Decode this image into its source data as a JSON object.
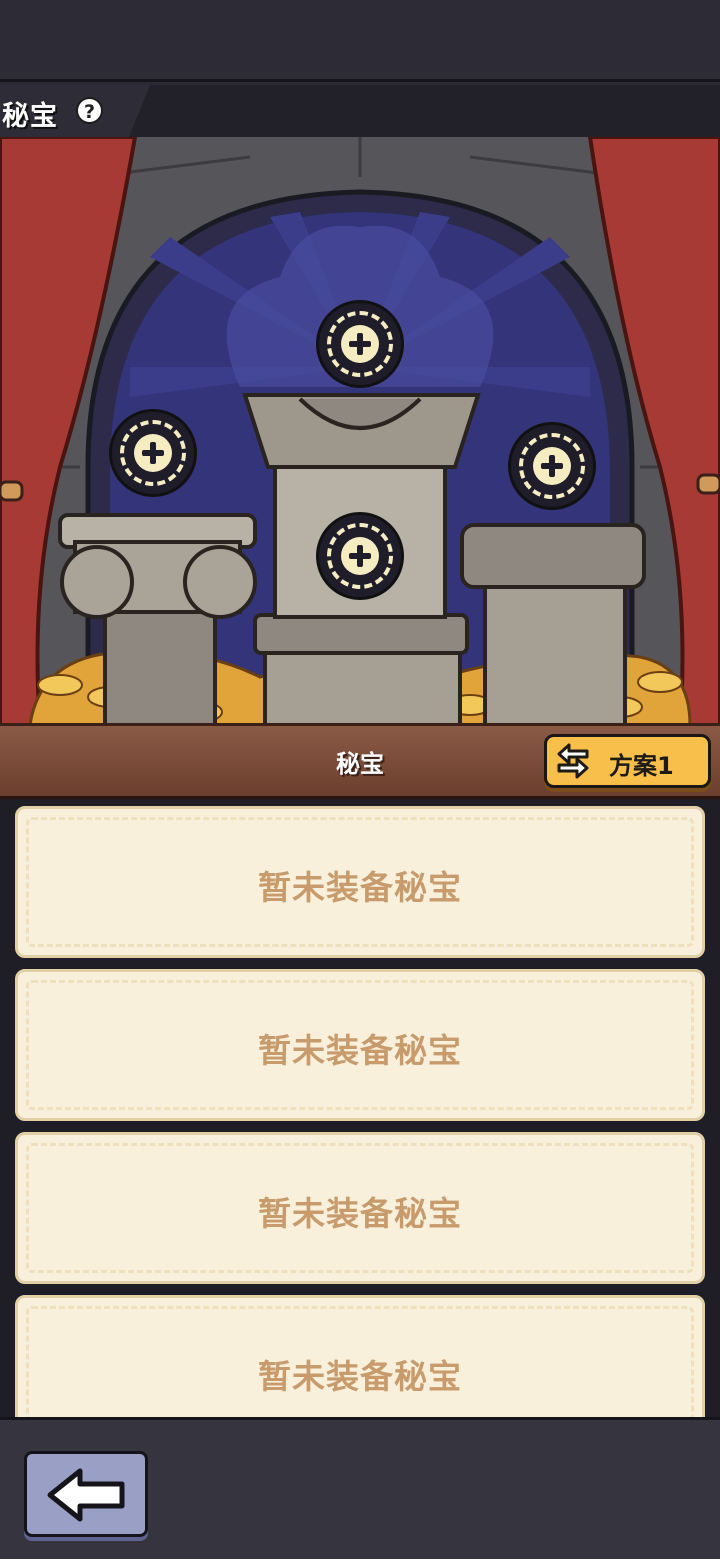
{
  "header": {
    "title": "秘宝",
    "help_icon": "question-icon",
    "help_glyph": "?"
  },
  "scene": {
    "slots": [
      {
        "name": "treasure-slot-top",
        "icon": "plus-icon"
      },
      {
        "name": "treasure-slot-left",
        "icon": "plus-icon"
      },
      {
        "name": "treasure-slot-right",
        "icon": "plus-icon"
      },
      {
        "name": "treasure-slot-center",
        "icon": "plus-icon"
      }
    ]
  },
  "shelf": {
    "title": "秘宝",
    "scheme_button": {
      "label": "方案1",
      "icon": "swap-arrows-icon"
    }
  },
  "list": {
    "items": [
      {
        "text": "暂未装备秘宝"
      },
      {
        "text": "暂未装备秘宝"
      },
      {
        "text": "暂未装备秘宝"
      },
      {
        "text": "暂未装备秘宝"
      }
    ]
  },
  "footer": {
    "back_icon": "arrow-left-icon"
  },
  "colors": {
    "accent_button": "#f8c04a",
    "card_bg": "#f8f0da",
    "card_text": "#c89b6d",
    "back_button": "#9aa0c5"
  }
}
